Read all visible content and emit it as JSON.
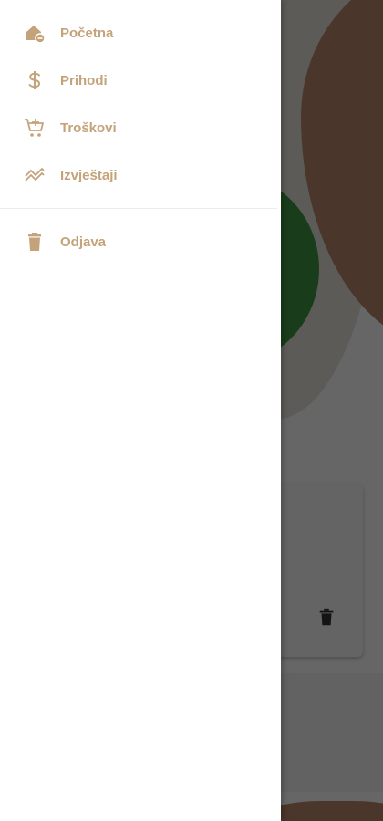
{
  "theme": {
    "accent": "#c5a37a",
    "drawer_bg": "#ffffff",
    "scrim": "rgba(0,0,0,0.6)"
  },
  "drawer": {
    "primary_items": [
      {
        "label": "Početna",
        "icon": "home-icon"
      },
      {
        "label": "Prihodi",
        "icon": "dollar-icon"
      },
      {
        "label": "Troškovi",
        "icon": "cart-add-icon"
      },
      {
        "label": "Izvještaji",
        "icon": "trend-chart-icon"
      }
    ],
    "secondary_items": [
      {
        "label": "Odjava",
        "icon": "trash-icon"
      }
    ]
  },
  "background": {
    "card_action_icon": "trash-icon"
  }
}
